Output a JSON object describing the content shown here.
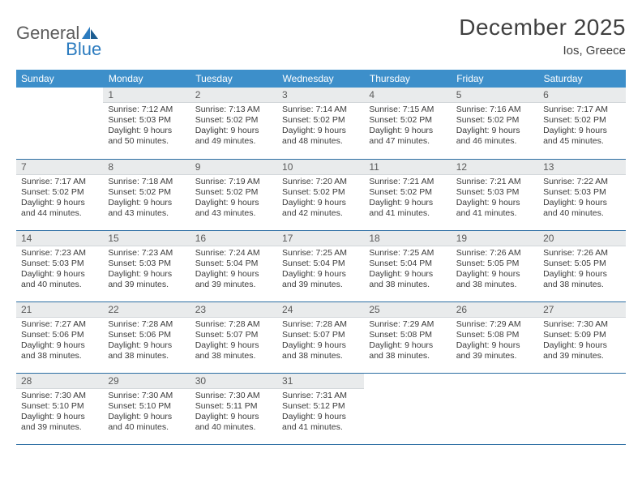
{
  "brand": {
    "part1": "General",
    "part2": "Blue"
  },
  "title": "December 2025",
  "location": "Ios, Greece",
  "weekdays": [
    "Sunday",
    "Monday",
    "Tuesday",
    "Wednesday",
    "Thursday",
    "Friday",
    "Saturday"
  ],
  "start_weekday_index": 1,
  "days": [
    {
      "n": 1,
      "sunrise": "7:12 AM",
      "sunset": "5:03 PM",
      "daylight": "9 hours and 50 minutes."
    },
    {
      "n": 2,
      "sunrise": "7:13 AM",
      "sunset": "5:02 PM",
      "daylight": "9 hours and 49 minutes."
    },
    {
      "n": 3,
      "sunrise": "7:14 AM",
      "sunset": "5:02 PM",
      "daylight": "9 hours and 48 minutes."
    },
    {
      "n": 4,
      "sunrise": "7:15 AM",
      "sunset": "5:02 PM",
      "daylight": "9 hours and 47 minutes."
    },
    {
      "n": 5,
      "sunrise": "7:16 AM",
      "sunset": "5:02 PM",
      "daylight": "9 hours and 46 minutes."
    },
    {
      "n": 6,
      "sunrise": "7:17 AM",
      "sunset": "5:02 PM",
      "daylight": "9 hours and 45 minutes."
    },
    {
      "n": 7,
      "sunrise": "7:17 AM",
      "sunset": "5:02 PM",
      "daylight": "9 hours and 44 minutes."
    },
    {
      "n": 8,
      "sunrise": "7:18 AM",
      "sunset": "5:02 PM",
      "daylight": "9 hours and 43 minutes."
    },
    {
      "n": 9,
      "sunrise": "7:19 AM",
      "sunset": "5:02 PM",
      "daylight": "9 hours and 43 minutes."
    },
    {
      "n": 10,
      "sunrise": "7:20 AM",
      "sunset": "5:02 PM",
      "daylight": "9 hours and 42 minutes."
    },
    {
      "n": 11,
      "sunrise": "7:21 AM",
      "sunset": "5:02 PM",
      "daylight": "9 hours and 41 minutes."
    },
    {
      "n": 12,
      "sunrise": "7:21 AM",
      "sunset": "5:03 PM",
      "daylight": "9 hours and 41 minutes."
    },
    {
      "n": 13,
      "sunrise": "7:22 AM",
      "sunset": "5:03 PM",
      "daylight": "9 hours and 40 minutes."
    },
    {
      "n": 14,
      "sunrise": "7:23 AM",
      "sunset": "5:03 PM",
      "daylight": "9 hours and 40 minutes."
    },
    {
      "n": 15,
      "sunrise": "7:23 AM",
      "sunset": "5:03 PM",
      "daylight": "9 hours and 39 minutes."
    },
    {
      "n": 16,
      "sunrise": "7:24 AM",
      "sunset": "5:04 PM",
      "daylight": "9 hours and 39 minutes."
    },
    {
      "n": 17,
      "sunrise": "7:25 AM",
      "sunset": "5:04 PM",
      "daylight": "9 hours and 39 minutes."
    },
    {
      "n": 18,
      "sunrise": "7:25 AM",
      "sunset": "5:04 PM",
      "daylight": "9 hours and 38 minutes."
    },
    {
      "n": 19,
      "sunrise": "7:26 AM",
      "sunset": "5:05 PM",
      "daylight": "9 hours and 38 minutes."
    },
    {
      "n": 20,
      "sunrise": "7:26 AM",
      "sunset": "5:05 PM",
      "daylight": "9 hours and 38 minutes."
    },
    {
      "n": 21,
      "sunrise": "7:27 AM",
      "sunset": "5:06 PM",
      "daylight": "9 hours and 38 minutes."
    },
    {
      "n": 22,
      "sunrise": "7:28 AM",
      "sunset": "5:06 PM",
      "daylight": "9 hours and 38 minutes."
    },
    {
      "n": 23,
      "sunrise": "7:28 AM",
      "sunset": "5:07 PM",
      "daylight": "9 hours and 38 minutes."
    },
    {
      "n": 24,
      "sunrise": "7:28 AM",
      "sunset": "5:07 PM",
      "daylight": "9 hours and 38 minutes."
    },
    {
      "n": 25,
      "sunrise": "7:29 AM",
      "sunset": "5:08 PM",
      "daylight": "9 hours and 38 minutes."
    },
    {
      "n": 26,
      "sunrise": "7:29 AM",
      "sunset": "5:08 PM",
      "daylight": "9 hours and 39 minutes."
    },
    {
      "n": 27,
      "sunrise": "7:30 AM",
      "sunset": "5:09 PM",
      "daylight": "9 hours and 39 minutes."
    },
    {
      "n": 28,
      "sunrise": "7:30 AM",
      "sunset": "5:10 PM",
      "daylight": "9 hours and 39 minutes."
    },
    {
      "n": 29,
      "sunrise": "7:30 AM",
      "sunset": "5:10 PM",
      "daylight": "9 hours and 40 minutes."
    },
    {
      "n": 30,
      "sunrise": "7:30 AM",
      "sunset": "5:11 PM",
      "daylight": "9 hours and 40 minutes."
    },
    {
      "n": 31,
      "sunrise": "7:31 AM",
      "sunset": "5:12 PM",
      "daylight": "9 hours and 41 minutes."
    }
  ],
  "labels": {
    "sunrise": "Sunrise:",
    "sunset": "Sunset:",
    "daylight": "Daylight:"
  }
}
